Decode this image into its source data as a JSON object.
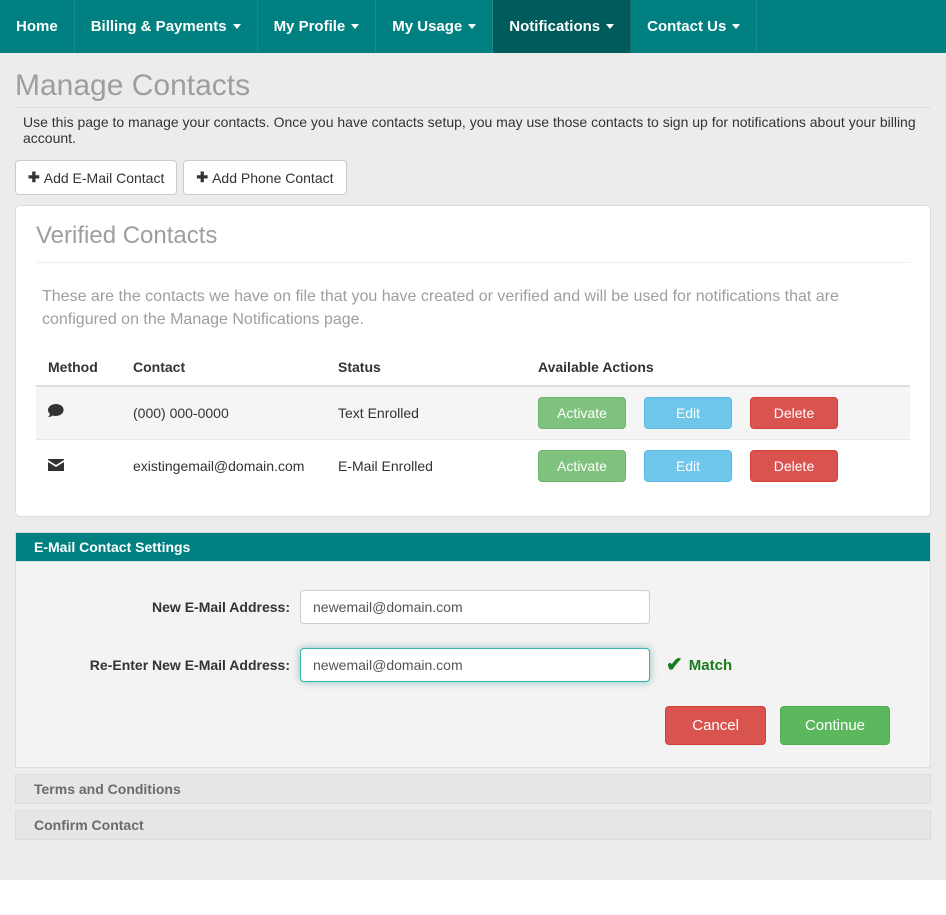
{
  "nav": {
    "items": [
      {
        "label": "Home",
        "dropdown": false
      },
      {
        "label": "Billing & Payments",
        "dropdown": true
      },
      {
        "label": "My Profile",
        "dropdown": true
      },
      {
        "label": "My Usage",
        "dropdown": true
      },
      {
        "label": "Notifications",
        "dropdown": true,
        "active": true
      },
      {
        "label": "Contact Us",
        "dropdown": true
      }
    ]
  },
  "page": {
    "title": "Manage Contacts",
    "description": "Use this page to manage your contacts. Once you have contacts setup, you may use those contacts to sign up for notifications about your billing account."
  },
  "toolbar": {
    "add_email_label": "Add E-Mail Contact",
    "add_phone_label": "Add Phone Contact"
  },
  "verified_panel": {
    "title": "Verified Contacts",
    "description": "These are the contacts we have on file that you have created or verified and will be used for notifications that are configured on the Manage Notifications page.",
    "columns": {
      "method": "Method",
      "contact": "Contact",
      "status": "Status",
      "actions": "Available Actions"
    },
    "rows": [
      {
        "icon": "comment",
        "contact": "(000) 000-0000",
        "status": "Text Enrolled"
      },
      {
        "icon": "envelope",
        "contact": "existingemail@domain.com",
        "status": "E-Mail Enrolled"
      }
    ],
    "actions": {
      "activate": "Activate",
      "edit": "Edit",
      "delete": "Delete"
    }
  },
  "email_section": {
    "header": "E-Mail Contact Settings",
    "new_label": "New E-Mail Address:",
    "reenter_label": "Re-Enter New E-Mail Address:",
    "new_value": "newemail@domain.com",
    "reenter_value": "newemail@domain.com",
    "match_text": "Match",
    "cancel": "Cancel",
    "continue": "Continue"
  },
  "other_sections": {
    "terms": "Terms and Conditions",
    "confirm": "Confirm Contact"
  }
}
